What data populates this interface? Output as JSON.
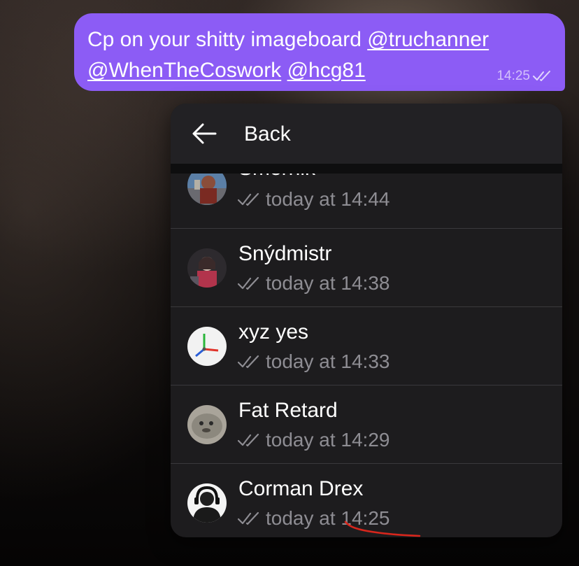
{
  "message": {
    "text_plain": "Cp on your shitty imageboard ",
    "mentions": [
      "@truchanner",
      "@WhenTheCoswork",
      "@hcg81"
    ],
    "time": "14:25",
    "bubble_color": "#8c5cf5"
  },
  "popup": {
    "back_label": "Back",
    "back_icon": "arrow-left-icon",
    "read_icon": "double-check-icon",
    "readers": [
      {
        "name": "Smernik",
        "status": "today at 14:44",
        "avatar": "avatar-smernik"
      },
      {
        "name": "Snýdmistr",
        "status": "today at 14:38",
        "avatar": "avatar-snydmistr"
      },
      {
        "name": "xyz yes",
        "status": "today at 14:33",
        "avatar": "avatar-xyz-axes"
      },
      {
        "name": "Fat Retard",
        "status": "today at 14:29",
        "avatar": "avatar-seal"
      },
      {
        "name": "Corman Drex",
        "status": "today at 14:25",
        "avatar": "avatar-corman"
      }
    ]
  },
  "annotation": {
    "color": "#d8261c"
  }
}
